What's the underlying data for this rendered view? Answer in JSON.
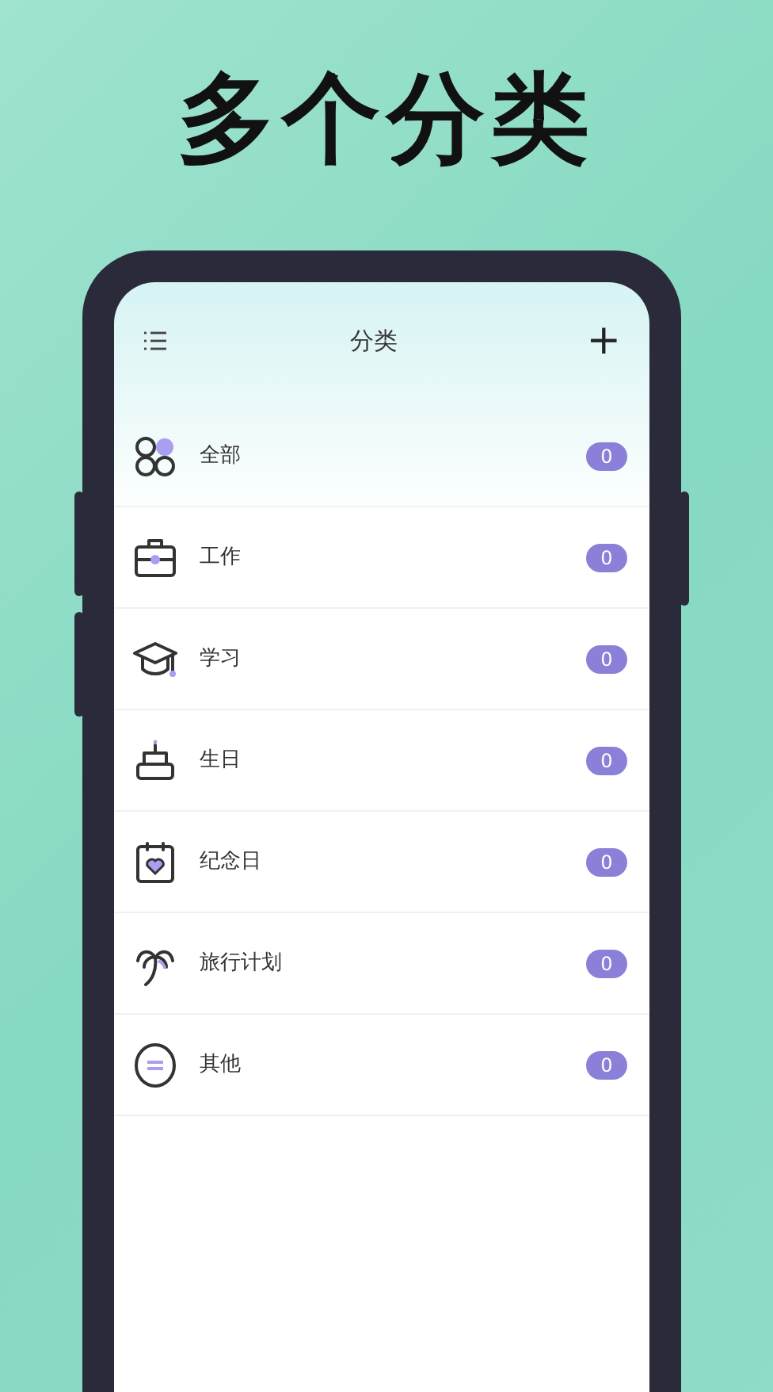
{
  "headline": "多个分类",
  "header": {
    "title": "分类",
    "add_button": "+"
  },
  "categories": [
    {
      "kind": "grid",
      "label": "全部",
      "count": "0"
    },
    {
      "kind": "briefcase",
      "label": "工作",
      "count": "0"
    },
    {
      "kind": "cap",
      "label": "学习",
      "count": "0"
    },
    {
      "kind": "cake",
      "label": "生日",
      "count": "0"
    },
    {
      "kind": "calendar",
      "label": "纪念日",
      "count": "0"
    },
    {
      "kind": "palm",
      "label": "旅行计划",
      "count": "0"
    },
    {
      "kind": "other",
      "label": "其他",
      "count": "0"
    }
  ]
}
